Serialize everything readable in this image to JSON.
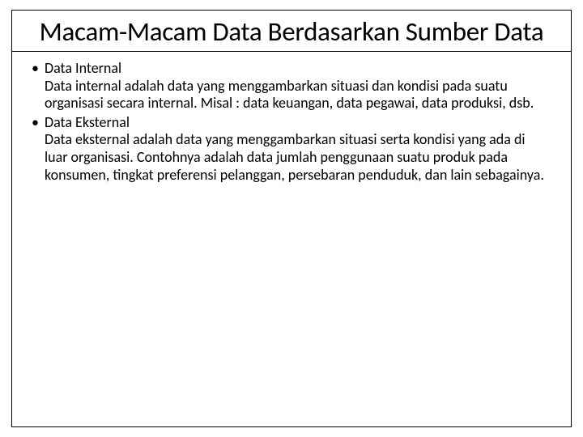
{
  "title": "Macam-Macam Data Berdasarkan Sumber Data",
  "bullets": [
    {
      "heading": "Data Internal",
      "description": "Data internal adalah data yang menggambarkan situasi dan kondisi pada suatu organisasi secara internal. Misal : data keuangan, data pegawai, data produksi, dsb."
    },
    {
      "heading": "Data Eksternal",
      "description": "Data eksternal adalah data yang menggambarkan situasi serta kondisi yang ada di luar organisasi. Contohnya adalah data jumlah penggunaan suatu produk pada konsumen, tingkat preferensi pelanggan, persebaran penduduk, dan lain sebagainya."
    }
  ]
}
